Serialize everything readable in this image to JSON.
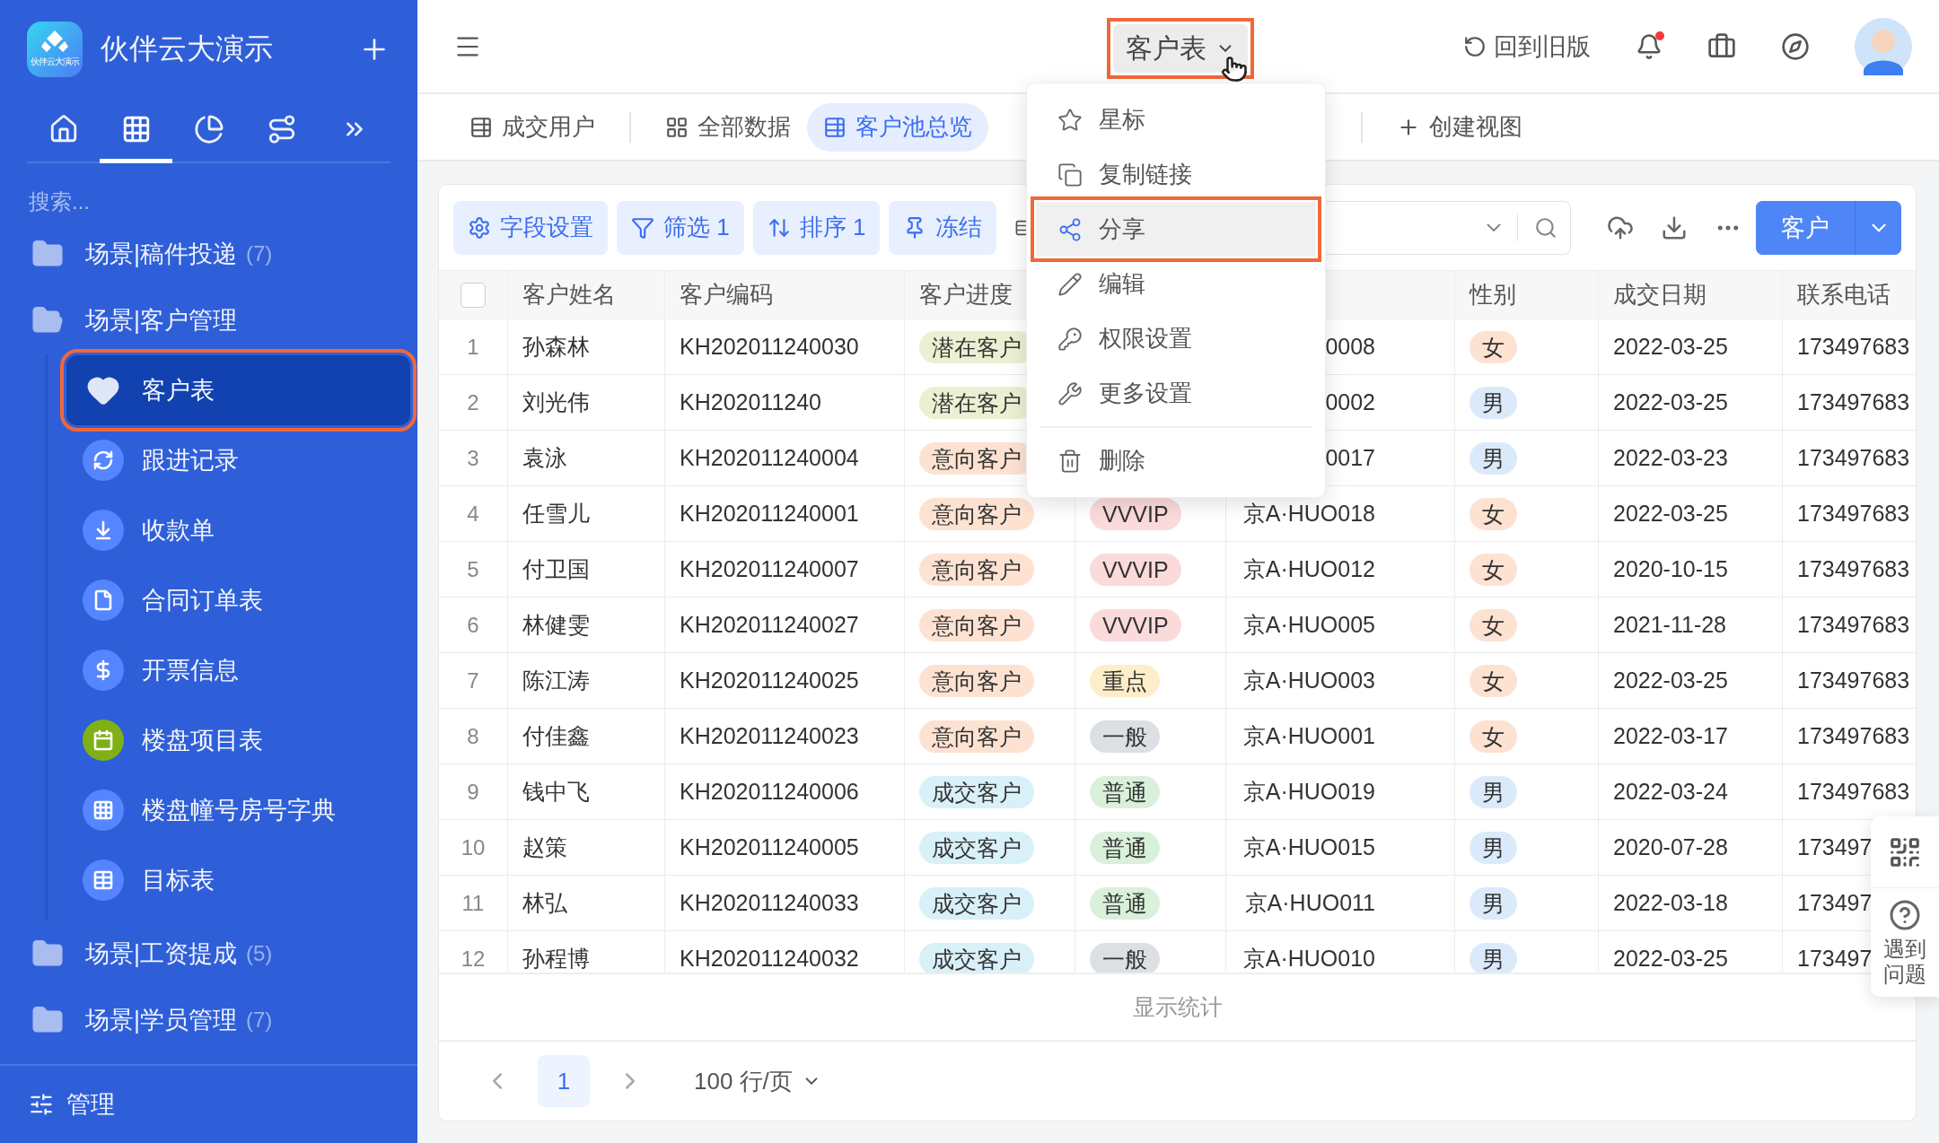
{
  "sidebar": {
    "app_name": "伙伴云大演示",
    "logo_text": "伙伴云大演示",
    "nav_tabs": [
      {
        "selected": false
      },
      {
        "selected": true
      },
      {
        "selected": false
      },
      {
        "selected": false
      },
      {
        "selected": false
      }
    ],
    "search": {
      "placeholder": "搜索..."
    },
    "tree": [
      {
        "label": "场景|稿件投递",
        "count": "(7)",
        "expanded": false
      },
      {
        "label": "场景|客户管理",
        "expanded": true,
        "children": [
          {
            "label": "客户表",
            "selected": true
          },
          {
            "label": "跟进记录",
            "selected": false,
            "color": "#5585ff"
          },
          {
            "label": "收款单",
            "selected": false,
            "color": "#5585ff"
          },
          {
            "label": "合同订单表",
            "selected": false,
            "color": "#5585ff"
          },
          {
            "label": "开票信息",
            "selected": false,
            "color": "#5585ff"
          },
          {
            "label": "楼盘项目表",
            "selected": false,
            "color": "#7fb116"
          },
          {
            "label": "楼盘幢号房号字典",
            "selected": false,
            "color": "#5585ff"
          },
          {
            "label": "目标表",
            "selected": false,
            "color": "#5585ff"
          }
        ]
      },
      {
        "label": "场景|工资提成",
        "count": "(5)",
        "expanded": false
      },
      {
        "label": "场景|学员管理",
        "count": "(7)",
        "expanded": false
      }
    ],
    "footer": "管理"
  },
  "header": {
    "title": "客户表",
    "legacy_link": "回到旧版",
    "notification_unread": true
  },
  "views": [
    {
      "label": "成交用户",
      "selected": false
    },
    {
      "label": "全部数据",
      "selected": false
    },
    {
      "label": "客户池总览",
      "selected": true
    }
  ],
  "create_view": "创建视图",
  "dropdown_menu": {
    "sections": [
      [
        {
          "label": "星标",
          "selected": false
        },
        {
          "label": "复制链接",
          "selected": false
        },
        {
          "label": "分享",
          "selected": true
        },
        {
          "label": "编辑",
          "selected": false
        },
        {
          "label": "权限设置",
          "selected": false
        },
        {
          "label": "更多设置",
          "selected": false
        }
      ],
      [
        {
          "label": "删除",
          "selected": false
        }
      ]
    ]
  },
  "toolbar": {
    "buttons": [
      "字段设置",
      "筛选 1",
      "排序 1",
      "冻结"
    ],
    "primary": "客户"
  },
  "table": {
    "select_all": {
      "checked": false
    },
    "columns": [
      "客户姓名",
      "客户编码",
      "客户进度",
      "性别",
      "成交日期",
      "联系电话"
    ],
    "rows": [
      {
        "index": "1",
        "name": "孙森林",
        "code": "KH202011240030",
        "progress": {
          "text": "潜在客户",
          "color": "#eaf1d2"
        },
        "plate": "0008",
        "gender": {
          "text": "女",
          "color": "#fde2d2"
        },
        "date": "2022-03-25",
        "phone": "173497683"
      },
      {
        "index": "2",
        "name": "刘光伟",
        "code": "KH202011240",
        "progress": {
          "text": "潜在客户",
          "color": "#eaf1d2"
        },
        "plate": "0002",
        "gender": {
          "text": "男",
          "color": "#dbeafb"
        },
        "date": "2022-03-25",
        "phone": "173497683"
      },
      {
        "index": "3",
        "name": "袁泳",
        "code": "KH202011240004",
        "progress": {
          "text": "意向客户",
          "color": "#fde2d2"
        },
        "plate": "0017",
        "gender": {
          "text": "男",
          "color": "#dbeafb"
        },
        "date": "2022-03-23",
        "phone": "173497683"
      },
      {
        "index": "4",
        "name": "任雪儿",
        "code": "KH202011240001",
        "progress": {
          "text": "意向客户",
          "color": "#fde2d2"
        },
        "level": {
          "text": "VVVIP",
          "color": "#fbdada"
        },
        "plate": "京A·HUO018",
        "gender": {
          "text": "女",
          "color": "#fde2d2"
        },
        "date": "2022-03-25",
        "phone": "173497683"
      },
      {
        "index": "5",
        "name": "付卫国",
        "code": "KH202011240007",
        "progress": {
          "text": "意向客户",
          "color": "#fde2d2"
        },
        "level": {
          "text": "VVVIP",
          "color": "#fbdada"
        },
        "plate": "京A·HUO012",
        "gender": {
          "text": "女",
          "color": "#fde2d2"
        },
        "date": "2020-10-15",
        "phone": "173497683"
      },
      {
        "index": "6",
        "name": "林健雯",
        "code": "KH202011240027",
        "progress": {
          "text": "意向客户",
          "color": "#fde2d2"
        },
        "level": {
          "text": "VVVIP",
          "color": "#fbdada"
        },
        "plate": "京A·HUO005",
        "gender": {
          "text": "女",
          "color": "#fde2d2"
        },
        "date": "2021-11-28",
        "phone": "173497683"
      },
      {
        "index": "7",
        "name": "陈江涛",
        "code": "KH202011240025",
        "progress": {
          "text": "意向客户",
          "color": "#fde2d2"
        },
        "level": {
          "text": "重点",
          "color": "#fdedc9"
        },
        "plate": "京A·HUO003",
        "gender": {
          "text": "女",
          "color": "#fde2d2"
        },
        "date": "2022-03-25",
        "phone": "173497683"
      },
      {
        "index": "8",
        "name": "付佳鑫",
        "code": "KH202011240023",
        "progress": {
          "text": "意向客户",
          "color": "#fde2d2"
        },
        "level": {
          "text": "一般",
          "color": "#dcdfe4"
        },
        "plate": "京A·HUO001",
        "gender": {
          "text": "女",
          "color": "#fde2d2"
        },
        "date": "2022-03-17",
        "phone": "173497683"
      },
      {
        "index": "9",
        "name": "钱中飞",
        "code": "KH202011240006",
        "progress": {
          "text": "成交客户",
          "color": "#d8f0f8"
        },
        "level": {
          "text": "普通",
          "color": "#d9f0da"
        },
        "plate": "京A·HUO019",
        "gender": {
          "text": "男",
          "color": "#dbeafb"
        },
        "date": "2022-03-24",
        "phone": "173497683"
      },
      {
        "index": "10",
        "name": "赵策",
        "code": "KH202011240005",
        "progress": {
          "text": "成交客户",
          "color": "#d8f0f8"
        },
        "level": {
          "text": "普通",
          "color": "#d9f0da"
        },
        "plate": "京A·HUO015",
        "gender": {
          "text": "男",
          "color": "#dbeafb"
        },
        "date": "2020-07-28",
        "phone": "173497"
      },
      {
        "index": "11",
        "name": "林弘",
        "code": "KH202011240033",
        "progress": {
          "text": "成交客户",
          "color": "#d8f0f8"
        },
        "level": {
          "text": "普通",
          "color": "#d9f0da"
        },
        "plate": "京A·HUO011",
        "gender": {
          "text": "男",
          "color": "#dbeafb"
        },
        "date": "2022-03-18",
        "phone": "173497"
      },
      {
        "index": "12",
        "name": "孙程博",
        "code": "KH202011240032",
        "progress": {
          "text": "成交客户",
          "color": "#d8f0f8"
        },
        "level": {
          "text": "一般",
          "color": "#dcdfe4"
        },
        "plate": "京A·HUO010",
        "gender": {
          "text": "男",
          "color": "#dbeafb"
        },
        "date": "2022-03-25",
        "phone": "173497"
      }
    ]
  },
  "stats": "显示统计",
  "pagination": {
    "page": "1",
    "page_size": "100 行/页"
  },
  "help": "遇到问题"
}
